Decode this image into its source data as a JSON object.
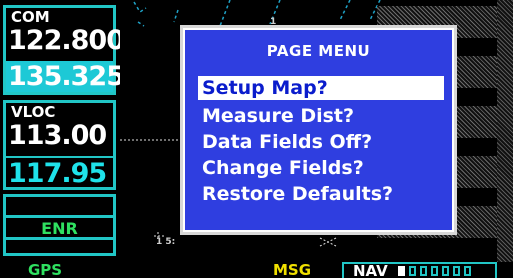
{
  "com": {
    "label": "COM",
    "active": "122.800",
    "standby": "135.325"
  },
  "vloc": {
    "label": "VLOC",
    "active": "113.00",
    "standby": "117.95"
  },
  "cdi": {
    "mode": "ENR"
  },
  "page_menu": {
    "title": "PAGE MENU",
    "items": [
      "Setup Map?",
      "Measure Dist?",
      "Data Fields Off?",
      "Change Fields?",
      "Restore Defaults?"
    ],
    "selected_index": 0
  },
  "status_bar": {
    "gps": "GPS",
    "msg": "MSG",
    "nav": "NAV",
    "page_count": 7,
    "current_page": 1
  },
  "colors": {
    "cyan": "#21c6c6",
    "menu_blue": "#2f3ee0",
    "green": "#2fe060",
    "yellow": "#f0e000"
  }
}
